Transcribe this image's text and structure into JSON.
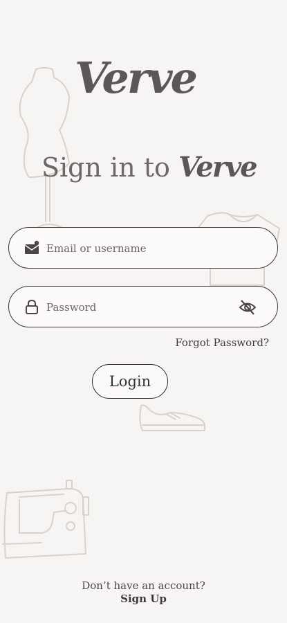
{
  "app": {
    "logo_text": "Verve"
  },
  "header": {
    "title_prefix": "Sign in to",
    "title_brand": "Verve"
  },
  "form": {
    "email": {
      "placeholder": "Email or username",
      "value": "",
      "icon": "email-icon"
    },
    "password": {
      "placeholder": "Password",
      "value": "",
      "icon": "lock-icon",
      "toggle_icon": "eye-off-icon"
    },
    "forgot_label": "Forgot Password?",
    "login_label": "Login"
  },
  "footer": {
    "no_account_text": "Don’t have an account?",
    "signup_label": "Sign Up"
  },
  "colors": {
    "background": "#f7f5f3",
    "text": "#4a4646",
    "outline": "#3a3636"
  }
}
